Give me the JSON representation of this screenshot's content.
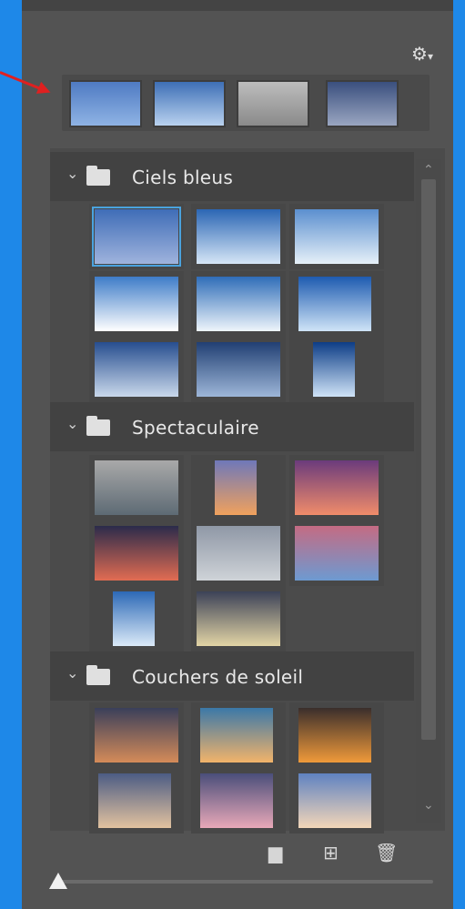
{
  "panel": {
    "settings_icon": "gear-icon",
    "groups": [
      {
        "label": "Ciels bleus"
      },
      {
        "label": "Spectaculaire"
      },
      {
        "label": "Couchers de soleil"
      }
    ],
    "bottom_icons": [
      "new-folder-icon",
      "add-icon",
      "trash-icon"
    ],
    "thumbnail_size": 0.0
  },
  "colors": {
    "accent": "#4aa3df",
    "annotation_arrow": "#e02020",
    "panel_bg": "#535353",
    "screen_bg": "#1e88e8"
  }
}
